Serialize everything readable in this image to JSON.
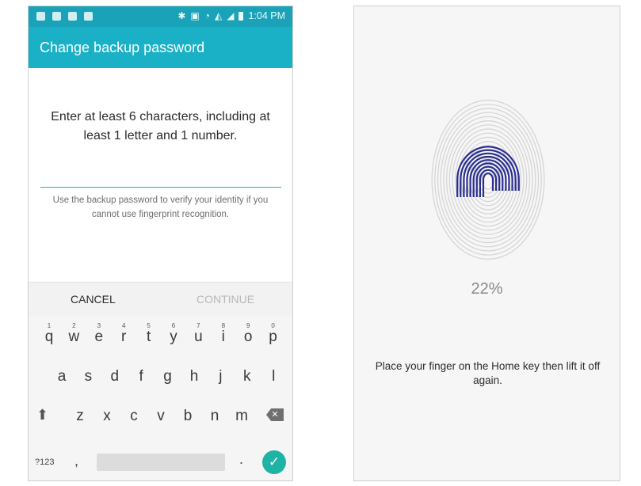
{
  "status_bar": {
    "time": "1:04 PM"
  },
  "backup_screen": {
    "title": "Change backup password",
    "instruction": "Enter at least 6 characters, including at least 1 letter and 1 number.",
    "password_value": "",
    "hint": "Use the backup password to verify your identity if you cannot use fingerprint recognition.",
    "cancel_label": "CANCEL",
    "continue_label": "CONTINUE",
    "accent_color": "#1ab0c6"
  },
  "keyboard": {
    "row1": [
      "q",
      "w",
      "e",
      "r",
      "t",
      "y",
      "u",
      "i",
      "o",
      "p"
    ],
    "row1_digits": [
      "1",
      "2",
      "3",
      "4",
      "5",
      "6",
      "7",
      "8",
      "9",
      "0"
    ],
    "row2": [
      "a",
      "s",
      "d",
      "f",
      "g",
      "h",
      "j",
      "k",
      "l"
    ],
    "row3": [
      "z",
      "x",
      "c",
      "v",
      "b",
      "n",
      "m"
    ],
    "symbols_label": "?123",
    "comma": ",",
    "period": ".",
    "icons": [
      "shift-icon",
      "backspace-icon",
      "checkmark-icon"
    ]
  },
  "fingerprint_screen": {
    "progress_percent": 22,
    "progress_label": "22%",
    "message": "Place your finger on the Home key then lift it off again.",
    "fingerprint_color": "#2a2f8f"
  }
}
